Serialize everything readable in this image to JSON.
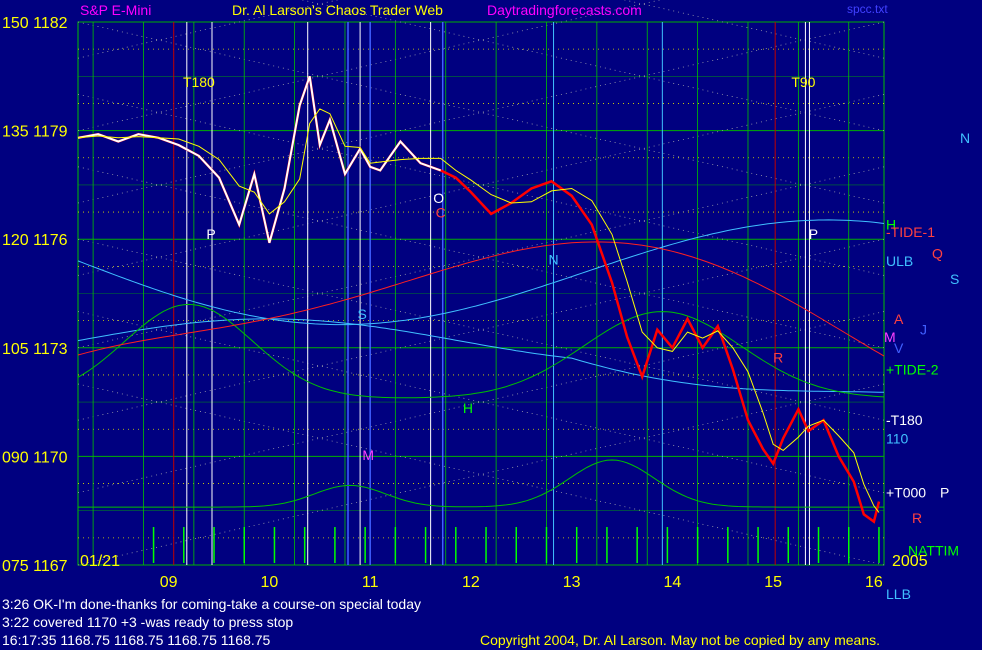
{
  "header": {
    "symbol": "S&P E-Mini",
    "title": "Dr. Al Larson's Chaos Trader Web",
    "site": "Daytradingforecasts.com",
    "file": "spcc.txt"
  },
  "messages": [
    "3:26 OK-I'm done-thanks for coming-take a course-on special today",
    "3:22 covered 1170 +3 -was ready to press stop",
    "16:17:35  1168.75 1168.75 1168.75 1168.75"
  ],
  "copyright": "Copyright 2004, Dr. Al Larson. May not be copied by any means.",
  "colors": {
    "background": "#000080",
    "price": "#ff0000",
    "price_early": "#ffffff",
    "grid": "#00c000",
    "label": "#ffff00"
  },
  "chart_data": {
    "type": "line",
    "date_label": "01/21",
    "year_label": "2005",
    "xlim": [
      8.1,
      16.1
    ],
    "x_ticks": [
      "09",
      "10",
      "11",
      "12",
      "13",
      "14",
      "15",
      "16"
    ],
    "ylim": [
      1167,
      1182
    ],
    "y_ticks": [
      {
        "left": "150",
        "right": "1182",
        "value": 1182
      },
      {
        "left": "135",
        "right": "1179",
        "value": 1179
      },
      {
        "left": "120",
        "right": "1176",
        "value": 1176
      },
      {
        "left": "105",
        "right": "1173",
        "value": 1173
      },
      {
        "left": "090",
        "right": "1170",
        "value": 1170
      },
      {
        "left": "075",
        "right": "1167",
        "value": 1167
      }
    ],
    "price": {
      "x": [
        8.1,
        8.3,
        8.5,
        8.7,
        8.9,
        9.1,
        9.3,
        9.5,
        9.7,
        9.85,
        10.0,
        10.15,
        10.3,
        10.4,
        10.5,
        10.6,
        10.75,
        10.9,
        11.0,
        11.1,
        11.3,
        11.5,
        11.7,
        11.85,
        12.0,
        12.2,
        12.4,
        12.6,
        12.8,
        13.0,
        13.2,
        13.4,
        13.55,
        13.7,
        13.85,
        14.0,
        14.15,
        14.3,
        14.45,
        14.6,
        14.75,
        14.9,
        15.0,
        15.1,
        15.25,
        15.35,
        15.5,
        15.65,
        15.8,
        15.9,
        16.0,
        16.05
      ],
      "y": [
        1178.8,
        1178.9,
        1178.7,
        1178.9,
        1178.8,
        1178.6,
        1178.3,
        1177.7,
        1176.4,
        1177.8,
        1175.9,
        1177.4,
        1179.7,
        1180.5,
        1178.6,
        1179.3,
        1177.8,
        1178.5,
        1178.0,
        1177.9,
        1178.7,
        1178.1,
        1177.9,
        1177.7,
        1177.3,
        1176.7,
        1177.0,
        1177.4,
        1177.6,
        1177.2,
        1176.4,
        1174.8,
        1173.3,
        1172.2,
        1173.5,
        1173.0,
        1173.8,
        1173.0,
        1173.6,
        1172.4,
        1171.0,
        1170.2,
        1169.8,
        1170.5,
        1171.3,
        1170.7,
        1171.0,
        1170.0,
        1169.3,
        1168.4,
        1168.2,
        1168.75
      ]
    },
    "level_labels": [
      {
        "text": "N",
        "value": 1178.8
      },
      {
        "text": "H",
        "value": 1176.4
      },
      {
        "text": "-TIDE-1",
        "value": 1176.2
      },
      {
        "text": "ULB",
        "value": 1175.4
      },
      {
        "text": "Q",
        "value": 1175.6
      },
      {
        "text": "S",
        "value": 1174.9
      },
      {
        "text": "A",
        "value": 1173.8
      },
      {
        "text": "J",
        "value": 1173.5
      },
      {
        "text": "M",
        "value": 1173.3
      },
      {
        "text": "V",
        "value": 1173.0
      },
      {
        "text": "+TIDE-2",
        "value": 1172.4
      },
      {
        "text": "-T180",
        "value": 1171.0
      },
      {
        "text": "110",
        "value": 1170.5
      },
      {
        "text": "+T000",
        "value": 1169.0
      },
      {
        "text": "P",
        "value": 1169.0
      },
      {
        "text": "R",
        "value": 1168.3
      },
      {
        "text": "NATTIM",
        "value": 1167.4
      },
      {
        "text": "LLB",
        "value": 1166.2
      }
    ],
    "inline_labels": [
      {
        "text": "T180",
        "x": 9.3,
        "value": 1180.2
      },
      {
        "text": "T90",
        "x": 15.3,
        "value": 1180.2
      },
      {
        "text": "P",
        "x": 9.42,
        "value": 1176.0
      },
      {
        "text": "P",
        "x": 15.4,
        "value": 1176.0
      },
      {
        "text": "O",
        "x": 11.68,
        "value": 1177.0
      },
      {
        "text": "C",
        "x": 11.7,
        "value": 1176.6
      },
      {
        "text": "N",
        "x": 12.82,
        "value": 1175.3
      },
      {
        "text": "S",
        "x": 10.92,
        "value": 1173.8
      },
      {
        "text": "H",
        "x": 11.97,
        "value": 1171.2
      },
      {
        "text": "M",
        "x": 10.98,
        "value": 1169.9
      },
      {
        "text": "R",
        "x": 15.05,
        "value": 1172.6
      }
    ]
  }
}
